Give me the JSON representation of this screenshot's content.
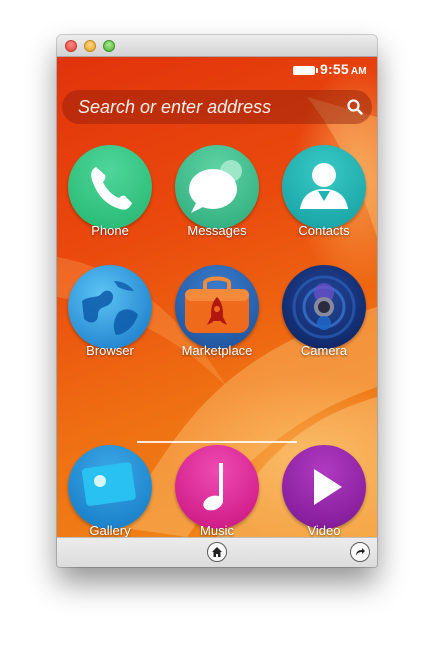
{
  "status": {
    "time": "9:55",
    "ampm": "AM"
  },
  "search": {
    "placeholder": "Search or enter address"
  },
  "apps": [
    {
      "label": "Phone",
      "icon": "phone-icon",
      "color": "#2ec27e"
    },
    {
      "label": "Messages",
      "icon": "speech-bubble-icon",
      "color": "#35b88a"
    },
    {
      "label": "Contacts",
      "icon": "person-icon",
      "color": "#1fb3b3"
    },
    {
      "label": "Browser",
      "icon": "globe-icon",
      "color": "#1e88d8"
    },
    {
      "label": "Marketplace",
      "icon": "rocket-bag-icon",
      "color": "#2c63b0"
    },
    {
      "label": "Camera",
      "icon": "camera-lens-icon",
      "color": "#0f2a6e"
    },
    {
      "label": "Gallery",
      "icon": "photo-icon",
      "color": "#1a8fd6"
    },
    {
      "label": "Music",
      "icon": "music-note-icon",
      "color": "#d81b8c"
    },
    {
      "label": "Video",
      "icon": "play-icon",
      "color": "#8e1fa0"
    }
  ],
  "colors": {
    "wallpaper_primary": "#e2330c",
    "wallpaper_secondary": "#f08a1a"
  }
}
